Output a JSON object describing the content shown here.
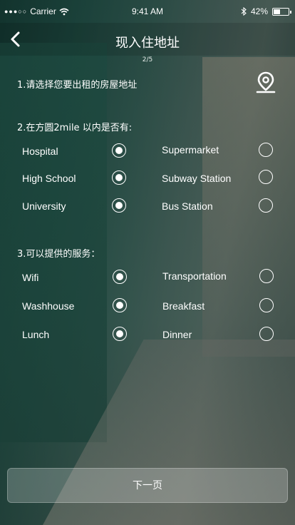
{
  "status_bar": {
    "carrier": "Carrier",
    "time": "9:41 AM",
    "battery_pct": "42%",
    "battery_level": 0.42
  },
  "nav": {
    "title": "现入住地址",
    "page_indicator": "2/5"
  },
  "section1": {
    "title": "1.请选择您要出租的房屋地址"
  },
  "section2": {
    "title": "2.在方圆2mile 以内是否有:",
    "options": [
      {
        "label": "Hospital",
        "checked": true
      },
      {
        "label": "Supermarket",
        "checked": false
      },
      {
        "label": "High School",
        "checked": true
      },
      {
        "label": "Subway Station",
        "checked": false
      },
      {
        "label": "University",
        "checked": true
      },
      {
        "label": "Bus Station",
        "checked": false
      }
    ]
  },
  "section3": {
    "title": "3.可以提供的服务：",
    "options": [
      {
        "label": "Wifi",
        "checked": true
      },
      {
        "label": "Transportation",
        "checked": false
      },
      {
        "label": "Washhouse",
        "checked": true
      },
      {
        "label": "Breakfast",
        "checked": false
      },
      {
        "label": "Lunch",
        "checked": true
      },
      {
        "label": "Dinner",
        "checked": false
      }
    ]
  },
  "next_button": {
    "label": "下一页"
  }
}
